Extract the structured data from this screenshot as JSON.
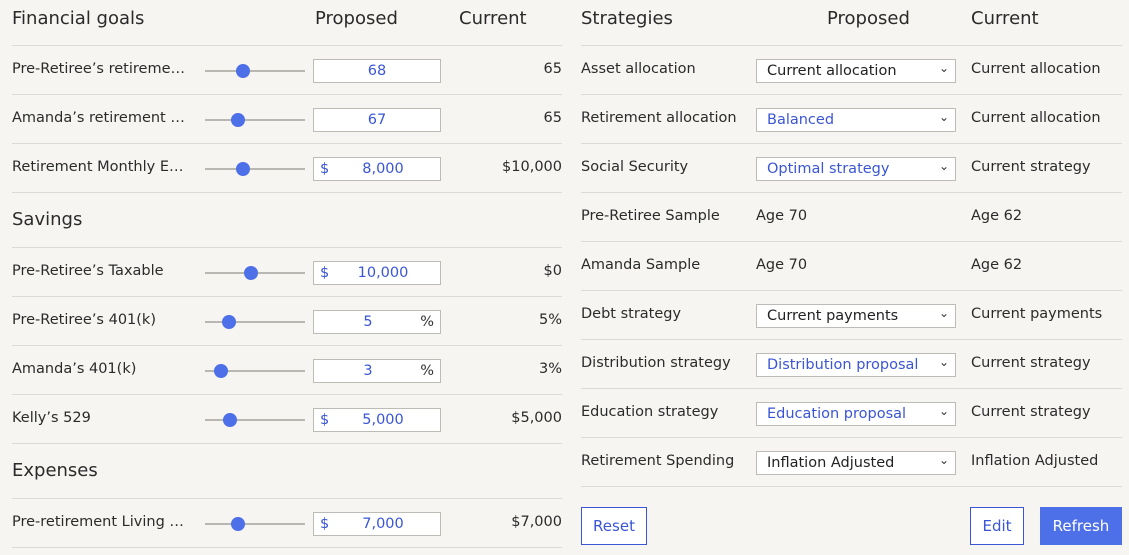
{
  "left": {
    "header": {
      "title": "Financial goals",
      "proposed": "Proposed",
      "current": "Current"
    },
    "goals": [
      {
        "label": "Pre-Retiree’s retirement age",
        "value": "68",
        "current": "65",
        "slider": 0.38
      },
      {
        "label": "Amanda’s retirement age",
        "value": "67",
        "current": "65",
        "slider": 0.33
      },
      {
        "label": "Retirement Monthly Expenses",
        "prefix": "$",
        "value": "8,000",
        "current": "$10,000",
        "slider": 0.38
      }
    ],
    "savings_title": "Savings",
    "savings": [
      {
        "label": "Pre-Retiree’s Taxable",
        "prefix": "$",
        "value": "10,000",
        "current": "$0",
        "slider": 0.46
      },
      {
        "label": "Pre-Retiree’s 401(k)",
        "suffix": "%",
        "value": "5",
        "current": "5%",
        "slider": 0.24
      },
      {
        "label": "Amanda’s 401(k)",
        "suffix": "%",
        "value": "3",
        "current": "3%",
        "slider": 0.16
      },
      {
        "label": "Kelly’s 529",
        "prefix": "$",
        "value": "5,000",
        "current": "$5,000",
        "slider": 0.25
      }
    ],
    "expenses_title": "Expenses",
    "expenses": [
      {
        "label": "Pre-retirement Living Expenses",
        "prefix": "$",
        "value": "7,000",
        "current": "$7,000",
        "slider": 0.33
      }
    ]
  },
  "right": {
    "header": {
      "title": "Strategies",
      "proposed": "Proposed",
      "current": "Current"
    },
    "rows": [
      {
        "label": "Asset allocation",
        "proposed": "Current allocation",
        "current": "Current allocation"
      },
      {
        "label": "Retirement allocation",
        "proposed": "Balanced",
        "current": "Current allocation"
      },
      {
        "label": "Social Security",
        "proposed": "Optimal strategy",
        "current": "Current strategy"
      },
      {
        "label": "Pre-Retiree Sample",
        "proposed": "Age 70",
        "current": "Age 62"
      },
      {
        "label": "Amanda Sample",
        "proposed": "Age 70",
        "current": "Age 62"
      },
      {
        "label": "Debt strategy",
        "proposed": "Current payments",
        "current": "Current payments"
      },
      {
        "label": "Distribution strategy",
        "proposed": "Distribution proposal",
        "current": "Current strategy"
      },
      {
        "label": "Education strategy",
        "proposed": "Education proposal",
        "current": "Current strategy"
      },
      {
        "label": "Retirement Spending",
        "proposed": "Inflation Adjusted",
        "current": "Inflation Adjusted"
      }
    ],
    "buttons": {
      "reset": "Reset",
      "edit": "Edit",
      "refresh": "Refresh"
    }
  },
  "colors": {
    "accent": "#4d6fe8",
    "value_text": "#3a55d6",
    "background": "#f6f5f2",
    "divider": "#dcdad6"
  },
  "icons": {
    "select_arrow": "chevron-down-icon",
    "slider_thumb": "slider-thumb"
  }
}
